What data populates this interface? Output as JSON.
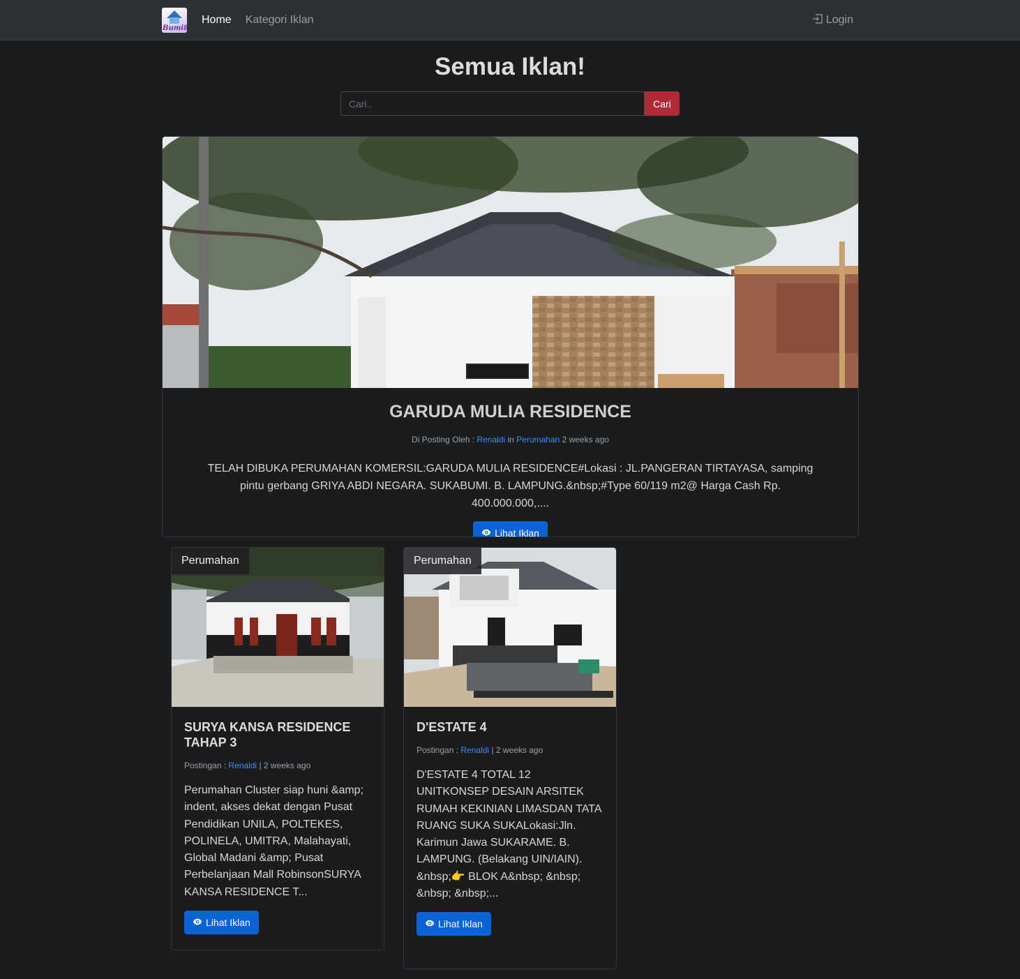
{
  "nav": {
    "logo_text": "Bumi88",
    "home": "Home",
    "categories": "Kategori Iklan",
    "login": "Login"
  },
  "header": {
    "title": "Semua Iklan!"
  },
  "search": {
    "placeholder": "Cari..",
    "button": "Cari"
  },
  "featured": {
    "title": "GARUDA MULIA RESIDENCE",
    "meta_prefix": "Di Posting Oleh :",
    "author": "Renaldi",
    "in_word": "in",
    "category": "Perumahan",
    "time": "2 weeks ago",
    "description": "TELAH DIBUKA PERUMAHAN KOMERSIL:GARUDA MULIA RESIDENCE#Lokasi : JL.PANGERAN TIRTAYASA, samping pintu gerbang GRIYA ABDI NEGARA. SUKABUMI. B. LAMPUNG.&nbsp;#Type 60/119 m2@ Harga Cash Rp. 400.000.000,....",
    "button": "Lihat Iklan",
    "button_icon": "eye-icon"
  },
  "cards": [
    {
      "badge": "Perumahan",
      "title": "SURYA KANSA RESIDENCE TAHAP 3",
      "meta_prefix": "Postingan :",
      "author": "Renaldi",
      "time": "| 2 weeks ago",
      "description": "Perumahan Cluster siap huni &amp; indent, akses dekat dengan Pusat Pendidikan UNILA, POLTEKES, POLINELA, UMITRA, Malahayati, Global Madani &amp; Pusat Perbelanjaan Mall RobinsonSURYA KANSA RESIDENCE T...",
      "button": "Lihat Iklan"
    },
    {
      "badge": "Perumahan",
      "title": "D'ESTATE 4",
      "meta_prefix": "Postingan :",
      "author": "Renaldi",
      "time": "| 2 weeks ago",
      "description": "D'ESTATE 4 TOTAL 12 UNITKONSEP DESAIN ARSITEK RUMAH KEKINIAN LIMASDAN TATA RUANG SUKA SUKALokasi:Jln. Karimun Jawa SUKARAME. B. LAMPUNG. (Belakang UIN/IAIN). &nbsp;👉 BLOK A&nbsp; &nbsp; &nbsp; &nbsp;...",
      "button": "Lihat Iklan"
    }
  ],
  "colors": {
    "background": "#1b1c1e",
    "navbar": "#2b3035",
    "primary": "#0b63d6",
    "danger": "#b02a37",
    "link": "#3d8bfd"
  }
}
